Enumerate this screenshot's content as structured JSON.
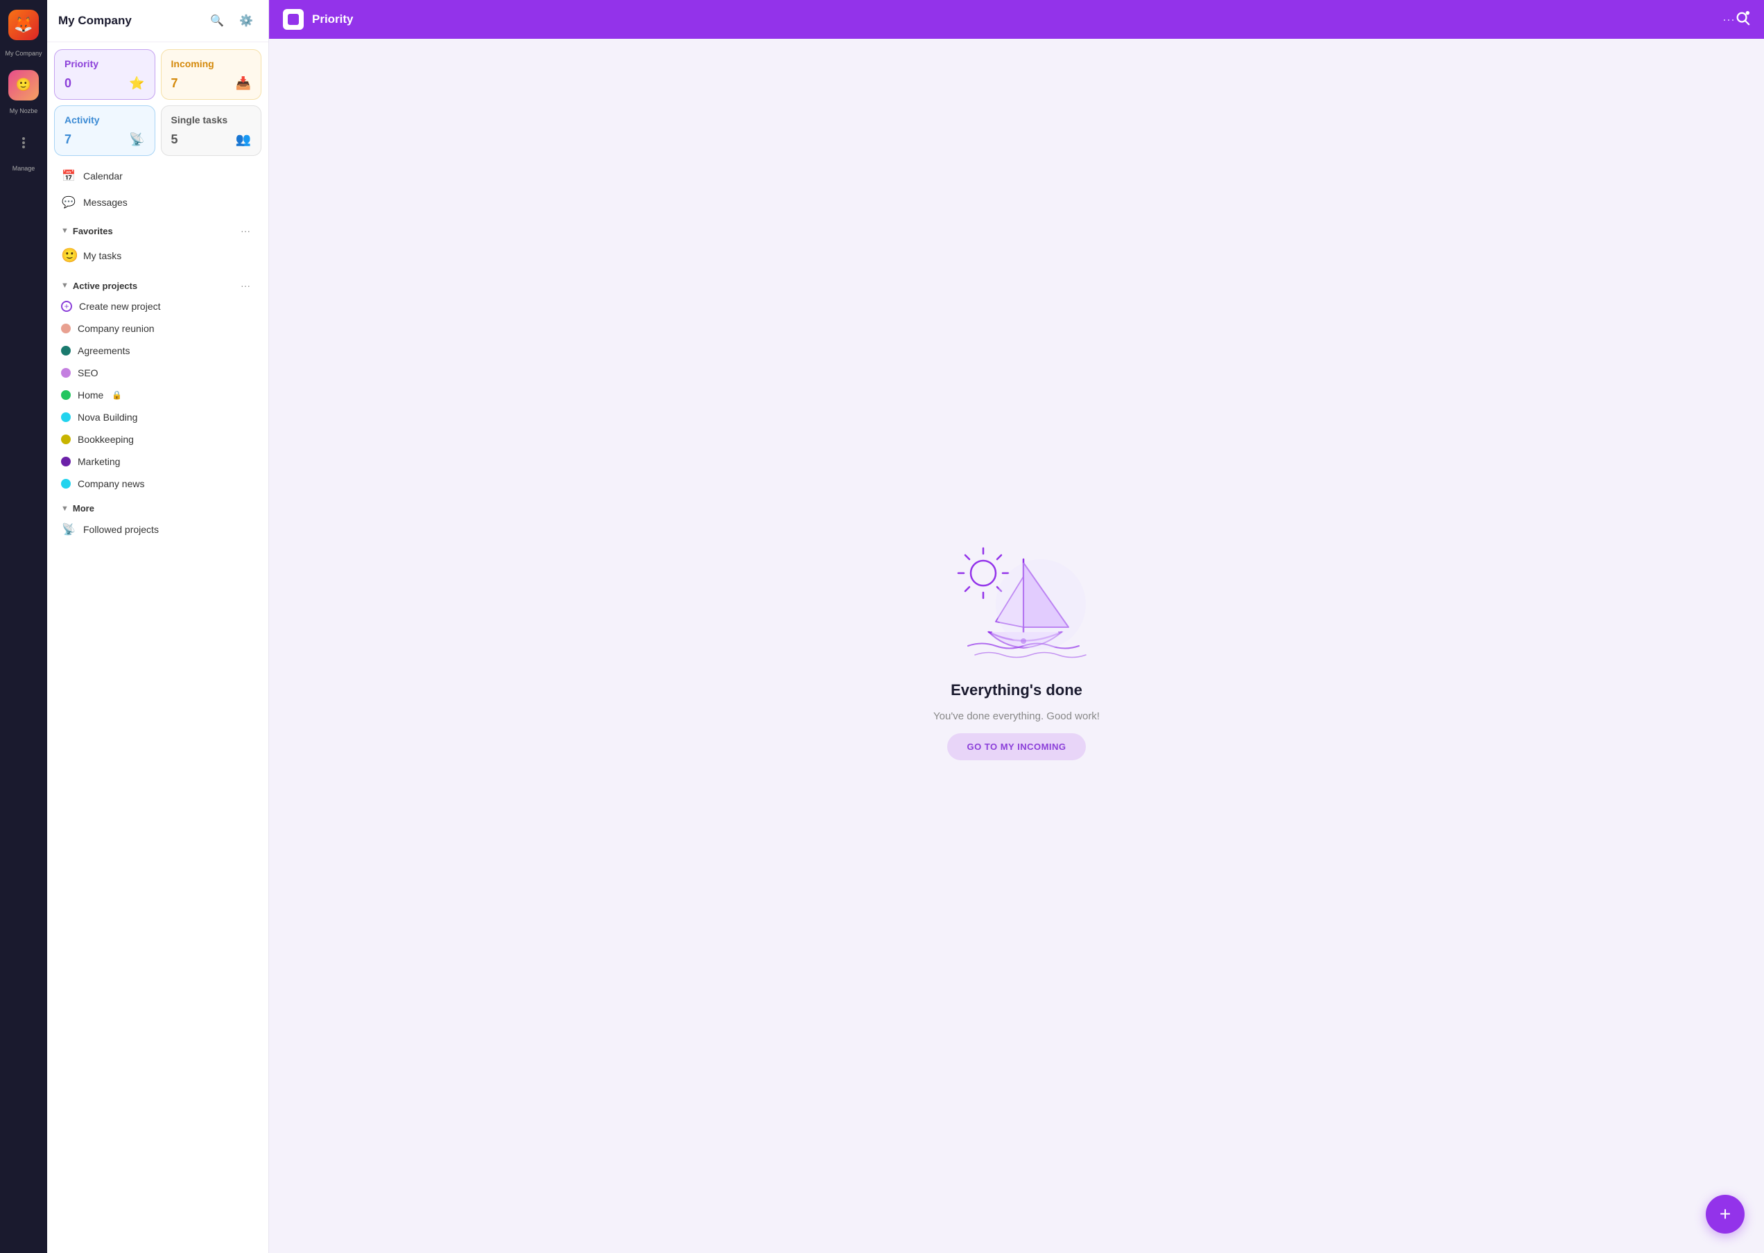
{
  "app": {
    "company_name": "My Company",
    "workspace_label": "My Company",
    "my_nozbe_label": "My Nozbe",
    "manage_label": "Manage"
  },
  "topbar": {
    "title": "Priority",
    "dots": "···",
    "logo_alt": "Nozbe logo"
  },
  "cards": [
    {
      "id": "priority",
      "label": "Priority",
      "count": "0",
      "icon": "⭐",
      "type": "priority"
    },
    {
      "id": "incoming",
      "label": "Incoming",
      "count": "7",
      "icon": "📥",
      "type": "incoming"
    },
    {
      "id": "activity",
      "label": "Activity",
      "count": "7",
      "icon": "📡",
      "type": "activity"
    },
    {
      "id": "single-tasks",
      "label": "Single tasks",
      "count": "5",
      "icon": "👥",
      "type": "single"
    }
  ],
  "nav_items": [
    {
      "id": "calendar",
      "label": "Calendar",
      "icon": "📅"
    },
    {
      "id": "messages",
      "label": "Messages",
      "icon": "💬"
    }
  ],
  "favorites": {
    "label": "Favorites",
    "more_btn": "···",
    "items": [
      {
        "id": "my-tasks",
        "label": "My tasks",
        "avatar": true
      }
    ]
  },
  "active_projects": {
    "label": "Active projects",
    "more_btn": "···",
    "items": [
      {
        "id": "create-new",
        "label": "Create new project",
        "dot_color": "outline"
      },
      {
        "id": "company-reunion",
        "label": "Company reunion",
        "dot_color": "#e8a090"
      },
      {
        "id": "agreements",
        "label": "Agreements",
        "dot_color": "#1a7a6e"
      },
      {
        "id": "seo",
        "label": "SEO",
        "dot_color": "#c47fe0"
      },
      {
        "id": "home",
        "label": "Home",
        "dot_color": "#22c55e",
        "lock": true
      },
      {
        "id": "nova-building",
        "label": "Nova Building",
        "dot_color": "#22d3ee"
      },
      {
        "id": "bookkeeping",
        "label": "Bookkeeping",
        "dot_color": "#c8b400"
      },
      {
        "id": "marketing",
        "label": "Marketing",
        "dot_color": "#6b21a8"
      },
      {
        "id": "company-news",
        "label": "Company news",
        "dot_color": "#22d3ee"
      }
    ]
  },
  "more_section": {
    "label": "More",
    "items": [
      {
        "id": "followed-projects",
        "label": "Followed projects",
        "icon": "📡"
      }
    ]
  },
  "empty_state": {
    "title": "Everything's done",
    "subtitle": "You've done everything. Good work!",
    "cta_label": "GO TO MY INCOMING"
  }
}
